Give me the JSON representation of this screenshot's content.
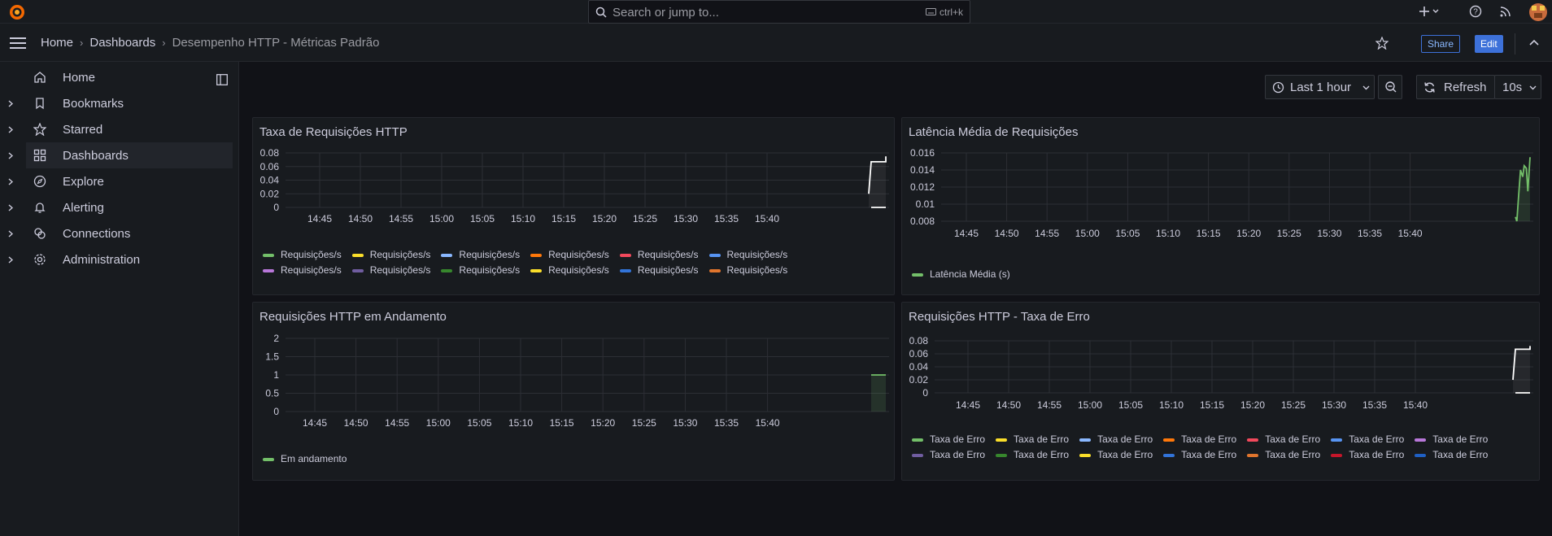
{
  "topbar": {
    "search_placeholder": "Search or jump to...",
    "search_shortcut": "ctrl+k"
  },
  "breadcrumb": [
    "Home",
    "Dashboards",
    "Desempenho HTTP - Métricas Padrão"
  ],
  "actions": {
    "share": "Share",
    "edit": "Edit"
  },
  "sidebar": {
    "items": [
      {
        "label": "Home",
        "icon": "home-icon"
      },
      {
        "label": "Bookmarks",
        "icon": "bookmark-icon"
      },
      {
        "label": "Starred",
        "icon": "star-icon"
      },
      {
        "label": "Dashboards",
        "icon": "grid-icon",
        "active": true
      },
      {
        "label": "Explore",
        "icon": "compass-icon"
      },
      {
        "label": "Alerting",
        "icon": "bell-icon"
      },
      {
        "label": "Connections",
        "icon": "plug-icon"
      },
      {
        "label": "Administration",
        "icon": "gear-icon"
      }
    ]
  },
  "toolbar": {
    "time_range": "Last 1 hour",
    "refresh": "Refresh",
    "interval": "10s"
  },
  "colors": {
    "accent": "#f27c3e",
    "primary": "#3d71d9",
    "green": "#73bf69"
  },
  "panels": [
    {
      "title": "Taxa de Requisições HTTP"
    },
    {
      "title": "Latência Média de Requisições"
    },
    {
      "title": "Requisições HTTP em Andamento"
    },
    {
      "title": "Requisições HTTP - Taxa de Erro"
    }
  ],
  "chart_data": [
    {
      "type": "line",
      "title": "Taxa de Requisições HTTP",
      "x_ticks": [
        "14:45",
        "14:50",
        "14:55",
        "15:00",
        "15:05",
        "15:10",
        "15:15",
        "15:20",
        "15:25",
        "15:30",
        "15:35",
        "15:40"
      ],
      "y_ticks": [
        "0",
        "0.02",
        "0.04",
        "0.06",
        "0.08"
      ],
      "ylim": [
        0,
        0.08
      ],
      "legend_placement": "bottom",
      "series": [
        {
          "name": "Requisições/s",
          "color": "#73bf69"
        },
        {
          "name": "Requisições/s",
          "color": "#fade2a"
        },
        {
          "name": "Requisições/s",
          "color": "#8ab8ff"
        },
        {
          "name": "Requisições/s",
          "color": "#ff780a"
        },
        {
          "name": "Requisições/s",
          "color": "#f2495c"
        },
        {
          "name": "Requisições/s",
          "color": "#5794f2"
        },
        {
          "name": "Requisições/s",
          "color": "#b877d9"
        },
        {
          "name": "Requisições/s",
          "color": "#705da0"
        },
        {
          "name": "Requisições/s",
          "color": "#37872d"
        },
        {
          "name": "Requisições/s",
          "color": "#fade2a"
        },
        {
          "name": "Requisições/s",
          "color": "#3274d9"
        },
        {
          "name": "Requisições/s",
          "color": "#e0752d"
        }
      ],
      "points": [
        [
          -1.1,
          0.02
        ],
        [
          0.0,
          0.067
        ],
        [
          1.0,
          0.067
        ],
        [
          1.1,
          0.075
        ]
      ]
    },
    {
      "type": "line",
      "title": "Latência Média de Requisições",
      "x_ticks": [
        "14:45",
        "14:50",
        "14:55",
        "15:00",
        "15:05",
        "15:10",
        "15:15",
        "15:20",
        "15:25",
        "15:30",
        "15:35",
        "15:40"
      ],
      "y_ticks": [
        "0.008",
        "0.01",
        "0.012",
        "0.014",
        "0.016"
      ],
      "ylim": [
        0.008,
        0.016
      ],
      "legend_placement": "bottom",
      "series": [
        {
          "name": "Latência Média (s)",
          "color": "#73bf69"
        }
      ],
      "points": [
        [
          0.0,
          0.0085
        ],
        [
          0.1,
          0.008
        ],
        [
          0.2,
          0.0105
        ],
        [
          0.35,
          0.014
        ],
        [
          0.5,
          0.0132
        ],
        [
          0.6,
          0.0145
        ],
        [
          0.75,
          0.0142
        ],
        [
          0.85,
          0.0115
        ],
        [
          1.0,
          0.0155
        ]
      ]
    },
    {
      "type": "line",
      "title": "Requisições HTTP em Andamento",
      "x_ticks": [
        "14:45",
        "14:50",
        "14:55",
        "15:00",
        "15:05",
        "15:10",
        "15:15",
        "15:20",
        "15:25",
        "15:30",
        "15:35",
        "15:40"
      ],
      "y_ticks": [
        "0",
        "0.5",
        "1",
        "1.5",
        "2"
      ],
      "ylim": [
        0,
        2
      ],
      "legend_placement": "bottom",
      "series": [
        {
          "name": "Em andamento",
          "color": "#73bf69"
        }
      ],
      "points": [
        [
          0.0,
          1
        ],
        [
          1.0,
          1
        ]
      ]
    },
    {
      "type": "line",
      "title": "Requisições HTTP - Taxa de Erro",
      "x_ticks": [
        "14:45",
        "14:50",
        "14:55",
        "15:00",
        "15:05",
        "15:10",
        "15:15",
        "15:20",
        "15:25",
        "15:30",
        "15:35",
        "15:40"
      ],
      "y_ticks": [
        "0",
        "0.02",
        "0.04",
        "0.06",
        "0.08"
      ],
      "ylim": [
        0,
        0.08
      ],
      "legend_placement": "bottom",
      "series": [
        {
          "name": "Taxa de Erro",
          "color": "#73bf69"
        },
        {
          "name": "Taxa de Erro",
          "color": "#fade2a"
        },
        {
          "name": "Taxa de Erro",
          "color": "#8ab8ff"
        },
        {
          "name": "Taxa de Erro",
          "color": "#ff780a"
        },
        {
          "name": "Taxa de Erro",
          "color": "#f2495c"
        },
        {
          "name": "Taxa de Erro",
          "color": "#5794f2"
        },
        {
          "name": "Taxa de Erro",
          "color": "#b877d9"
        },
        {
          "name": "Taxa de Erro",
          "color": "#705da0"
        },
        {
          "name": "Taxa de Erro",
          "color": "#37872d"
        },
        {
          "name": "Taxa de Erro",
          "color": "#fade2a"
        },
        {
          "name": "Taxa de Erro",
          "color": "#3274d9"
        },
        {
          "name": "Taxa de Erro",
          "color": "#e0752d"
        },
        {
          "name": "Taxa de Erro",
          "color": "#c4162a"
        },
        {
          "name": "Taxa de Erro",
          "color": "#1f60c4"
        }
      ],
      "points": [
        [
          -1.1,
          0.02
        ],
        [
          0.0,
          0.067
        ],
        [
          1.0,
          0.067
        ],
        [
          1.1,
          0.072
        ]
      ]
    }
  ]
}
